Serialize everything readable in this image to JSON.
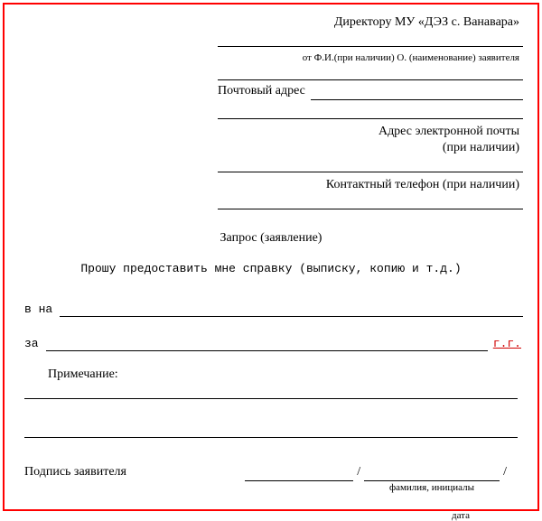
{
  "header": {
    "addressee": "Директору МУ «ДЭЗ с. Ванавара»",
    "from_hint": "от Ф.И.(при наличии) О. (наименование) заявителя",
    "postal_label": "Почтовый адрес",
    "email_label_1": "Адрес электронной почты",
    "email_label_2": "(при наличии)",
    "phone_label": "Контактный телефон (при наличии)"
  },
  "body": {
    "title": "Запрос (заявление)",
    "request_text": "Прошу предоставить мне справку (выписку, копию и т.д.)",
    "prefix_vna": "в на",
    "prefix_za": "за",
    "suffix_year": "г.г.",
    "note_label": "Примечание:"
  },
  "sign": {
    "label": "Подпись заявителя",
    "name_caption": "фамилия, инициалы",
    "date_caption": "дата"
  }
}
